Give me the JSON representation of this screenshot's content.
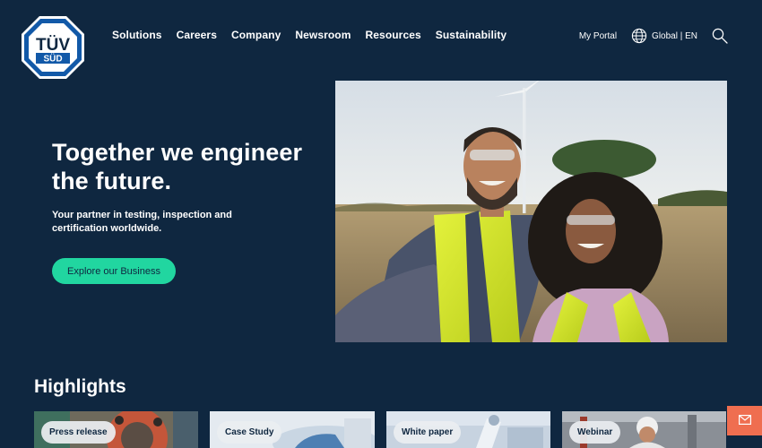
{
  "brand": {
    "logo_line1": "TÜV",
    "logo_line2": "SÜD",
    "logo_color": "#1259a8"
  },
  "header": {
    "nav": [
      {
        "label": "Solutions"
      },
      {
        "label": "Careers"
      },
      {
        "label": "Company"
      },
      {
        "label": "Newsroom"
      },
      {
        "label": "Resources"
      },
      {
        "label": "Sustainability"
      }
    ],
    "portal_label": "My Portal",
    "language_label": "Global | EN",
    "icons": {
      "language": "globe-icon",
      "search": "search-icon"
    }
  },
  "hero": {
    "title": "Together we engineer the future.",
    "subtitle": "Your partner in testing, inspection and certification worldwide.",
    "cta_label": "Explore our Business",
    "image": "two workers in hi-vis vests taking a selfie in a field with a wind turbine"
  },
  "highlights": {
    "title": "Highlights",
    "cards": [
      {
        "tag": "Press release"
      },
      {
        "tag": "Case Study"
      },
      {
        "tag": "White paper"
      },
      {
        "tag": "Webinar"
      }
    ]
  },
  "contact": {
    "icon": "mail-icon"
  },
  "colors": {
    "background": "#0f2740",
    "accent": "#21d6a0",
    "contact": "#ef6e50",
    "logo_blue": "#1259a8"
  }
}
